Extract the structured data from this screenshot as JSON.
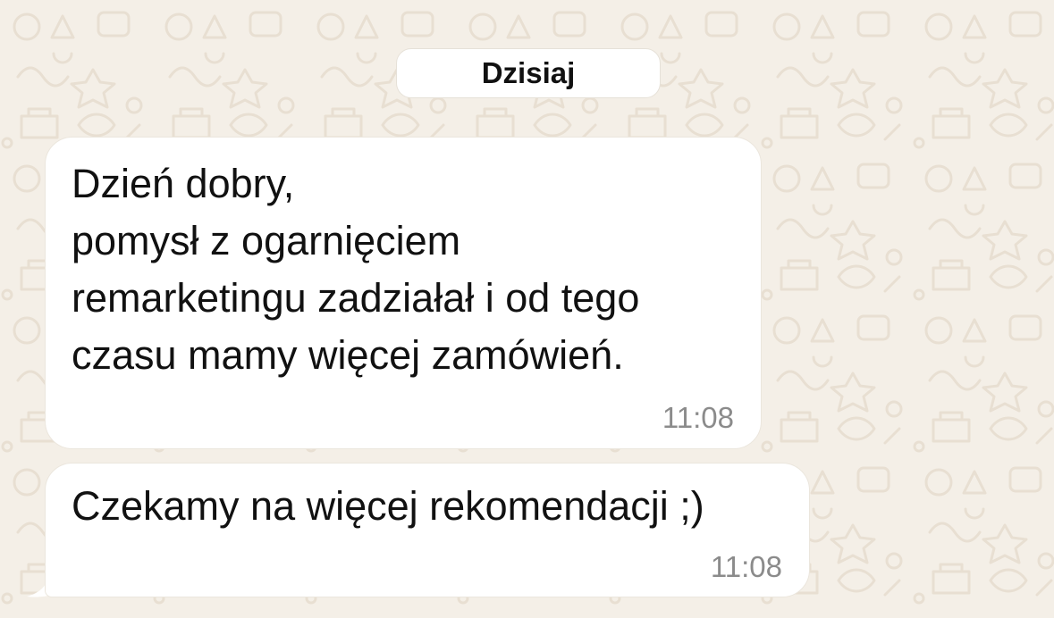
{
  "chat": {
    "date_separator": "Dzisiaj",
    "messages": [
      {
        "lines": [
          "Dzień dobry,",
          "pomysł z ogarnięciem",
          "remarketingu zadziałał i od tego",
          "czasu mamy więcej zamówień."
        ],
        "time": "11:08"
      },
      {
        "text": "Czekamy na więcej rekomendacji ;)",
        "time": "11:08"
      }
    ]
  },
  "colors": {
    "wallpaper": "#f4efe7",
    "wallpaper_doodle": "#e8dfd2",
    "bubble": "#ffffff",
    "text": "#111111",
    "timestamp": "#8b8b8b"
  }
}
